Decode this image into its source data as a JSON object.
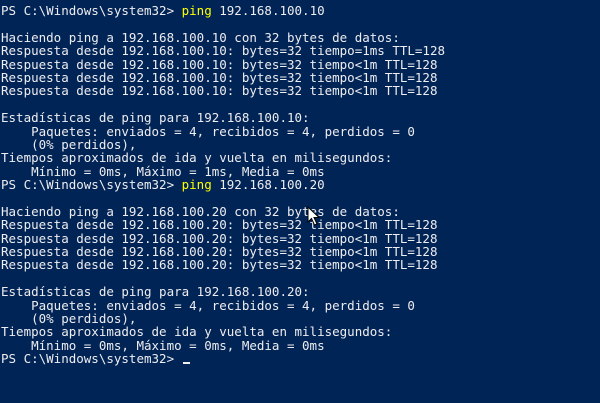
{
  "window": {
    "background": "#012456",
    "text_color": "#eeedf0",
    "command_color": "#ffff00"
  },
  "prompt1": {
    "prompt": "PS C:\\Windows\\system32> ",
    "command": "ping",
    "args": " 192.168.100.10"
  },
  "ping1": {
    "header": "Haciendo ping a 192.168.100.10 con 32 bytes de datos:",
    "replies": [
      "Respuesta desde 192.168.100.10: bytes=32 tiempo=1ms TTL=128",
      "Respuesta desde 192.168.100.10: bytes=32 tiempo<1m TTL=128",
      "Respuesta desde 192.168.100.10: bytes=32 tiempo<1m TTL=128",
      "Respuesta desde 192.168.100.10: bytes=32 tiempo<1m TTL=128"
    ],
    "stats_title": "Estadísticas de ping para 192.168.100.10:",
    "packets": "    Paquetes: enviados = 4, recibidos = 4, perdidos = 0",
    "lost_pct": "    (0% perdidos),",
    "times_title": "Tiempos aproximados de ida y vuelta en milisegundos:",
    "times": "    Mínimo = 0ms, Máximo = 1ms, Media = 0ms"
  },
  "prompt2": {
    "prompt": "PS C:\\Windows\\system32> ",
    "command": "ping",
    "args": " 192.168.100.20"
  },
  "ping2": {
    "header": "Haciendo ping a 192.168.100.20 con 32 bytes de datos:",
    "replies": [
      "Respuesta desde 192.168.100.20: bytes=32 tiempo<1m TTL=128",
      "Respuesta desde 192.168.100.20: bytes=32 tiempo<1m TTL=128",
      "Respuesta desde 192.168.100.20: bytes=32 tiempo<1m TTL=128",
      "Respuesta desde 192.168.100.20: bytes=32 tiempo<1m TTL=128"
    ],
    "stats_title": "Estadísticas de ping para 192.168.100.20:",
    "packets": "    Paquetes: enviados = 4, recibidos = 4, perdidos = 0",
    "lost_pct": "    (0% perdidos),",
    "times_title": "Tiempos aproximados de ida y vuelta en milisegundos:",
    "times": "    Mínimo = 0ms, Máximo = 0ms, Media = 0ms"
  },
  "prompt3": {
    "prompt": "PS C:\\Windows\\system32> "
  }
}
